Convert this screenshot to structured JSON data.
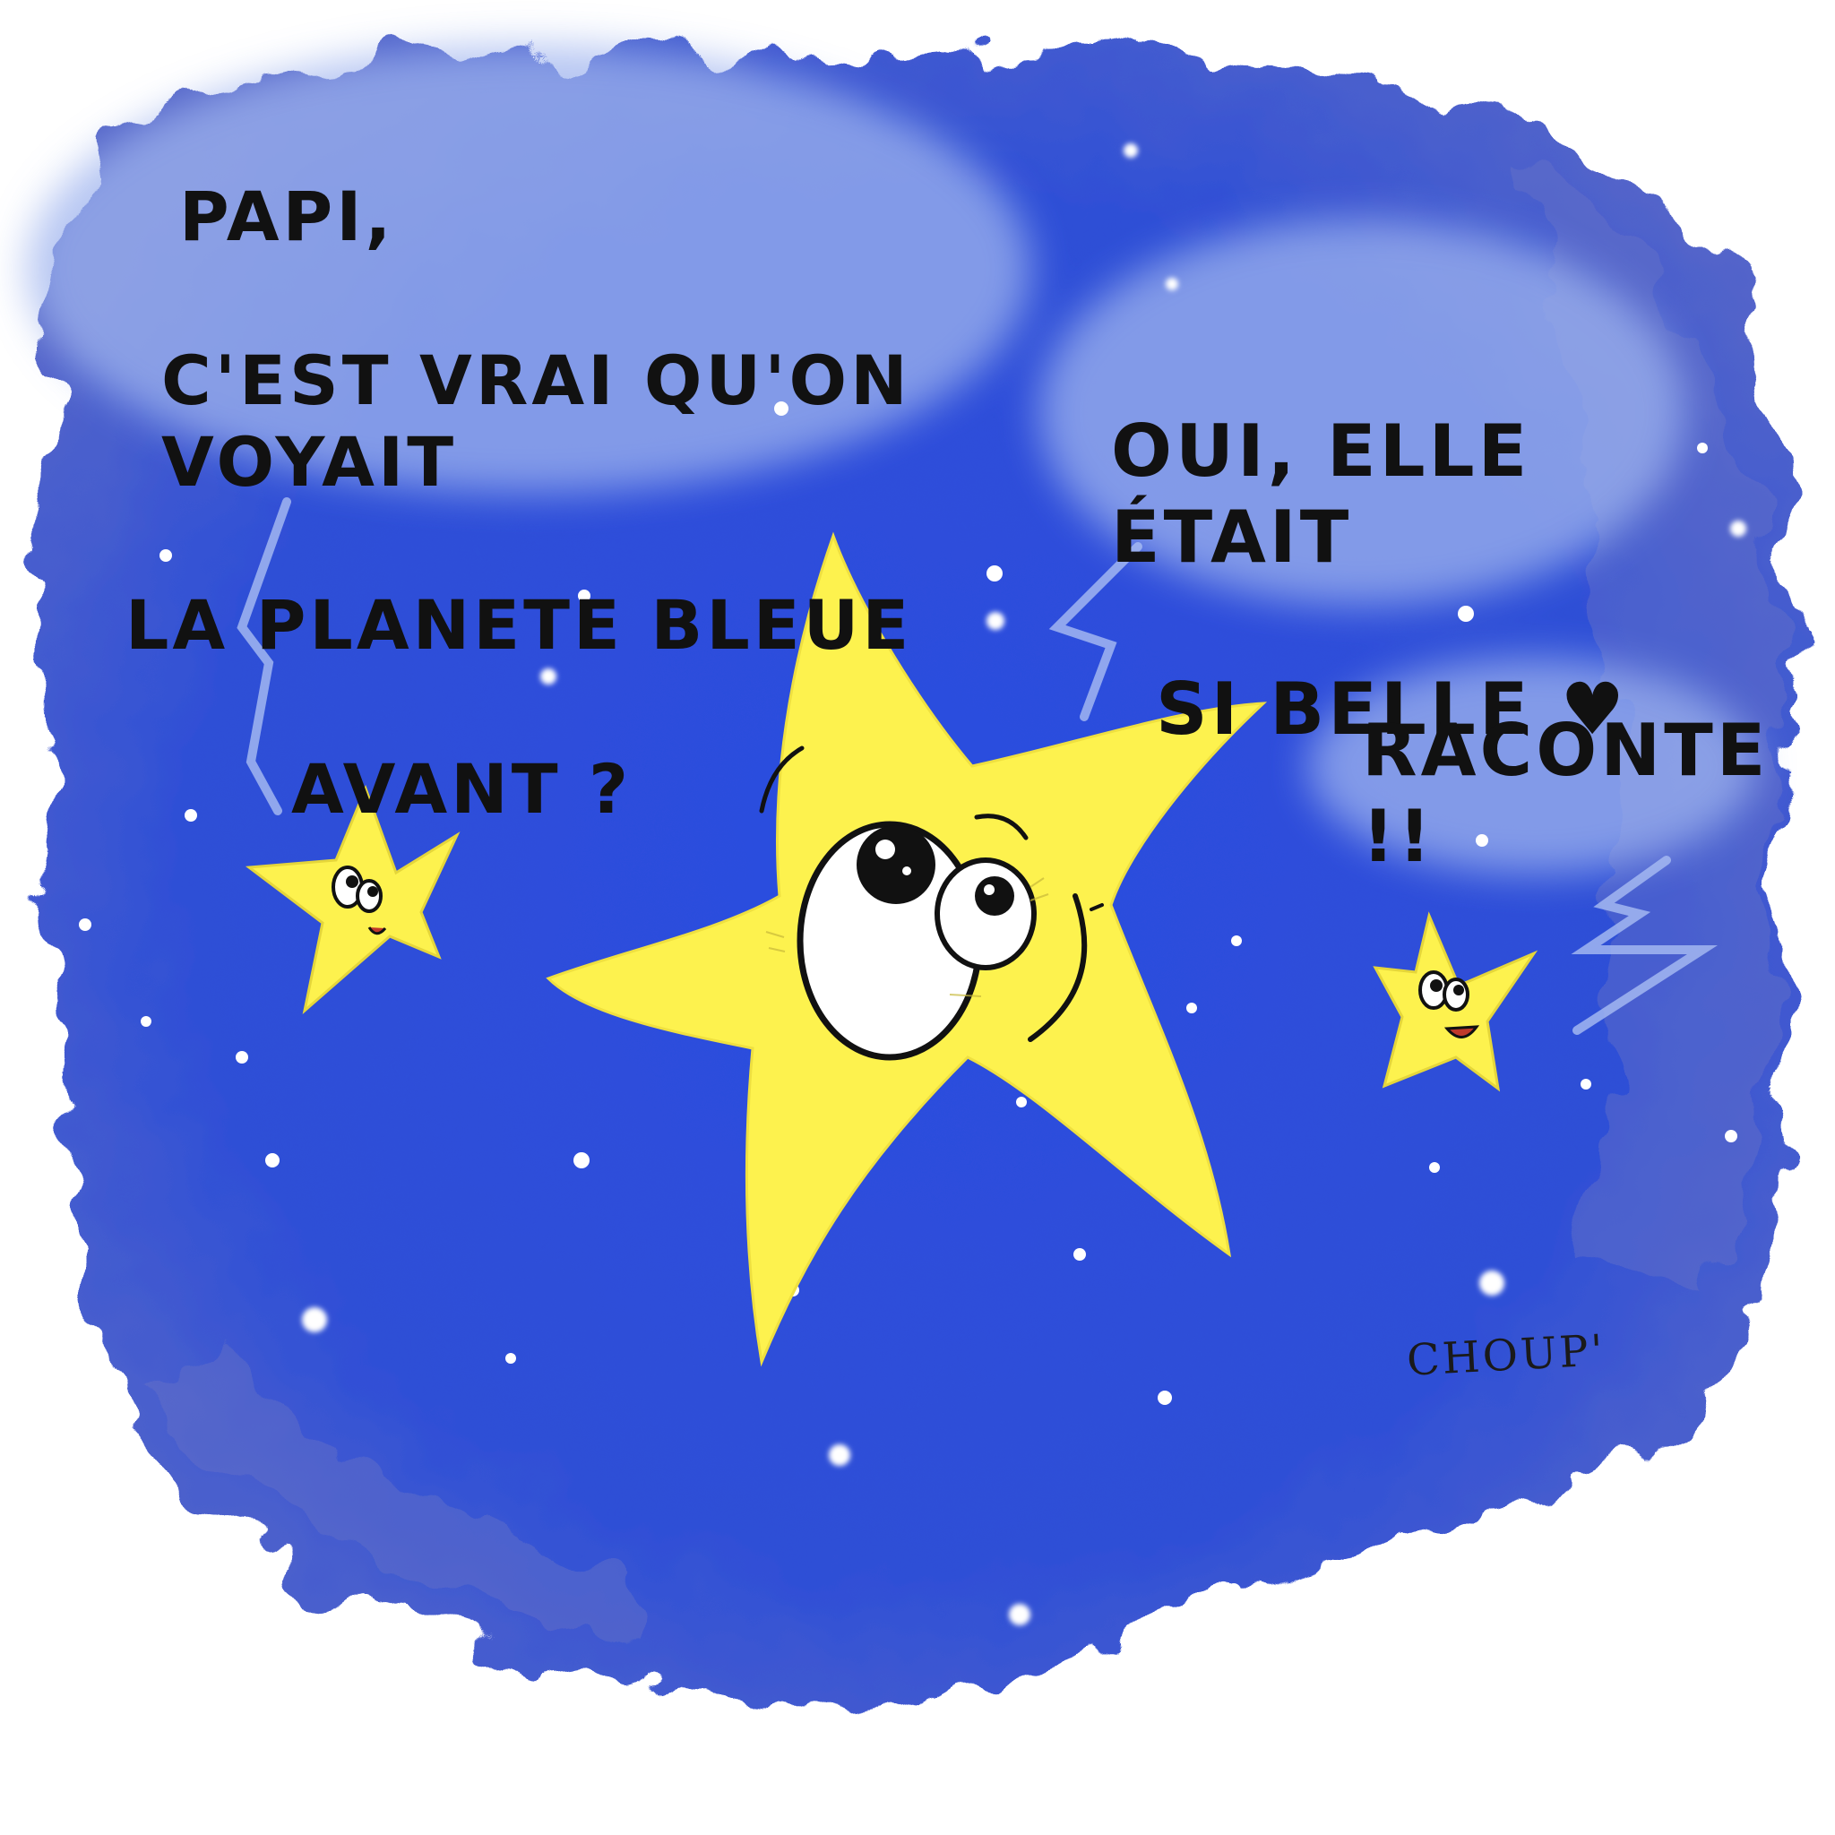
{
  "speech_papi": {
    "lines": [
      "PAPI,",
      "C'EST VRAI QU'ON VOYAIT",
      "LA PLANETE BLEUE",
      "AVANT ?"
    ]
  },
  "speech_oui": {
    "lines": [
      "OUI, ELLE ÉTAIT",
      "SI BELLE ♥"
    ]
  },
  "speech_raconte": {
    "text": "RACONTE !!"
  },
  "signature": "CHOUP'",
  "colors": {
    "sky": "#2d4fdc",
    "sky_dark": "#243fc0",
    "cloud": "#9fb4ee",
    "star_yellow": "#fdf24e",
    "background": "#ffffff"
  }
}
